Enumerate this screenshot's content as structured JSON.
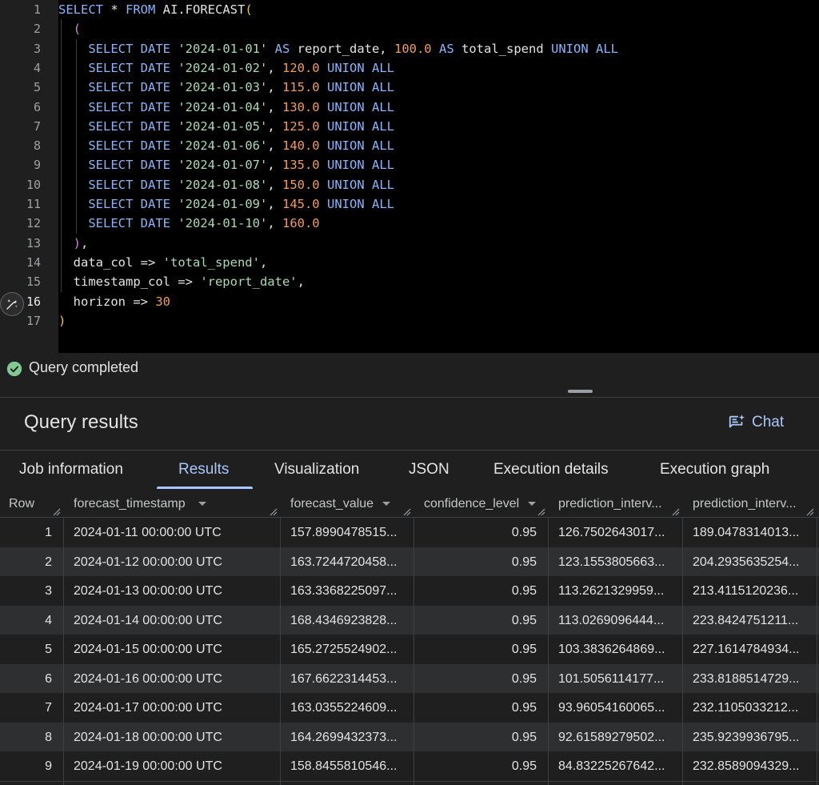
{
  "editor": {
    "line_numbers": [
      "1",
      "2",
      "3",
      "4",
      "5",
      "6",
      "7",
      "8",
      "9",
      "10",
      "11",
      "12",
      "13",
      "14",
      "15",
      "16",
      "17"
    ],
    "active_line": "16",
    "lines": [
      [
        {
          "t": "kw",
          "v": "SELECT"
        },
        {
          "t": "plain",
          "v": " * "
        },
        {
          "t": "kw",
          "v": "FROM"
        },
        {
          "t": "plain",
          "v": " AI.FORECAST"
        },
        {
          "t": "paren-o",
          "v": "("
        }
      ],
      [
        {
          "t": "plain",
          "v": "  "
        },
        {
          "t": "paren-p",
          "v": "("
        }
      ],
      [
        {
          "t": "plain",
          "v": "    "
        },
        {
          "t": "kw",
          "v": "SELECT DATE"
        },
        {
          "t": "plain",
          "v": " "
        },
        {
          "t": "str",
          "v": "'2024-01-01'"
        },
        {
          "t": "plain",
          "v": " "
        },
        {
          "t": "kw",
          "v": "AS"
        },
        {
          "t": "plain",
          "v": " report_date, "
        },
        {
          "t": "num",
          "v": "100.0"
        },
        {
          "t": "plain",
          "v": " "
        },
        {
          "t": "kw",
          "v": "AS"
        },
        {
          "t": "plain",
          "v": " total_spend "
        },
        {
          "t": "kw",
          "v": "UNION ALL"
        }
      ],
      [
        {
          "t": "plain",
          "v": "    "
        },
        {
          "t": "kw",
          "v": "SELECT DATE"
        },
        {
          "t": "plain",
          "v": " "
        },
        {
          "t": "str",
          "v": "'2024-01-02'"
        },
        {
          "t": "plain",
          "v": ", "
        },
        {
          "t": "num",
          "v": "120.0"
        },
        {
          "t": "plain",
          "v": " "
        },
        {
          "t": "kw",
          "v": "UNION ALL"
        }
      ],
      [
        {
          "t": "plain",
          "v": "    "
        },
        {
          "t": "kw",
          "v": "SELECT DATE"
        },
        {
          "t": "plain",
          "v": " "
        },
        {
          "t": "str",
          "v": "'2024-01-03'"
        },
        {
          "t": "plain",
          "v": ", "
        },
        {
          "t": "num",
          "v": "115.0"
        },
        {
          "t": "plain",
          "v": " "
        },
        {
          "t": "kw",
          "v": "UNION ALL"
        }
      ],
      [
        {
          "t": "plain",
          "v": "    "
        },
        {
          "t": "kw",
          "v": "SELECT DATE"
        },
        {
          "t": "plain",
          "v": " "
        },
        {
          "t": "str",
          "v": "'2024-01-04'"
        },
        {
          "t": "plain",
          "v": ", "
        },
        {
          "t": "num",
          "v": "130.0"
        },
        {
          "t": "plain",
          "v": " "
        },
        {
          "t": "kw",
          "v": "UNION ALL"
        }
      ],
      [
        {
          "t": "plain",
          "v": "    "
        },
        {
          "t": "kw",
          "v": "SELECT DATE"
        },
        {
          "t": "plain",
          "v": " "
        },
        {
          "t": "str",
          "v": "'2024-01-05'"
        },
        {
          "t": "plain",
          "v": ", "
        },
        {
          "t": "num",
          "v": "125.0"
        },
        {
          "t": "plain",
          "v": " "
        },
        {
          "t": "kw",
          "v": "UNION ALL"
        }
      ],
      [
        {
          "t": "plain",
          "v": "    "
        },
        {
          "t": "kw",
          "v": "SELECT DATE"
        },
        {
          "t": "plain",
          "v": " "
        },
        {
          "t": "str",
          "v": "'2024-01-06'"
        },
        {
          "t": "plain",
          "v": ", "
        },
        {
          "t": "num",
          "v": "140.0"
        },
        {
          "t": "plain",
          "v": " "
        },
        {
          "t": "kw",
          "v": "UNION ALL"
        }
      ],
      [
        {
          "t": "plain",
          "v": "    "
        },
        {
          "t": "kw",
          "v": "SELECT DATE"
        },
        {
          "t": "plain",
          "v": " "
        },
        {
          "t": "str",
          "v": "'2024-01-07'"
        },
        {
          "t": "plain",
          "v": ", "
        },
        {
          "t": "num",
          "v": "135.0"
        },
        {
          "t": "plain",
          "v": " "
        },
        {
          "t": "kw",
          "v": "UNION ALL"
        }
      ],
      [
        {
          "t": "plain",
          "v": "    "
        },
        {
          "t": "kw",
          "v": "SELECT DATE"
        },
        {
          "t": "plain",
          "v": " "
        },
        {
          "t": "str",
          "v": "'2024-01-08'"
        },
        {
          "t": "plain",
          "v": ", "
        },
        {
          "t": "num",
          "v": "150.0"
        },
        {
          "t": "plain",
          "v": " "
        },
        {
          "t": "kw",
          "v": "UNION ALL"
        }
      ],
      [
        {
          "t": "plain",
          "v": "    "
        },
        {
          "t": "kw",
          "v": "SELECT DATE"
        },
        {
          "t": "plain",
          "v": " "
        },
        {
          "t": "str",
          "v": "'2024-01-09'"
        },
        {
          "t": "plain",
          "v": ", "
        },
        {
          "t": "num",
          "v": "145.0"
        },
        {
          "t": "plain",
          "v": " "
        },
        {
          "t": "kw",
          "v": "UNION ALL"
        }
      ],
      [
        {
          "t": "plain",
          "v": "    "
        },
        {
          "t": "kw",
          "v": "SELECT DATE"
        },
        {
          "t": "plain",
          "v": " "
        },
        {
          "t": "str",
          "v": "'2024-01-10'"
        },
        {
          "t": "plain",
          "v": ", "
        },
        {
          "t": "num",
          "v": "160.0"
        }
      ],
      [
        {
          "t": "plain",
          "v": "  "
        },
        {
          "t": "paren-p",
          "v": ")"
        },
        {
          "t": "plain",
          "v": ","
        }
      ],
      [
        {
          "t": "plain",
          "v": "  data_col => "
        },
        {
          "t": "str",
          "v": "'total_spend'"
        },
        {
          "t": "plain",
          "v": ","
        }
      ],
      [
        {
          "t": "plain",
          "v": "  timestamp_col => "
        },
        {
          "t": "str",
          "v": "'report_date'"
        },
        {
          "t": "plain",
          "v": ","
        }
      ],
      [
        {
          "t": "plain",
          "v": "  horizon => "
        },
        {
          "t": "num",
          "v": "30"
        }
      ],
      [
        {
          "t": "paren-o",
          "v": ")"
        }
      ]
    ]
  },
  "status": {
    "text": "Query completed",
    "icon": "check-circle-icon",
    "color": "#81c995"
  },
  "results": {
    "title": "Query results",
    "chat_label": "Chat",
    "tabs": [
      "Job information",
      "Results",
      "Visualization",
      "JSON",
      "Execution details",
      "Execution graph"
    ],
    "active_tab": "Results"
  },
  "table": {
    "columns": [
      "Row",
      "forecast_timestamp",
      "forecast_value",
      "confidence_level",
      "prediction_interv...",
      "prediction_interv..."
    ],
    "rows": [
      [
        "1",
        "2024-01-11 00:00:00 UTC",
        "157.8990478515...",
        "0.95",
        "126.7502643017...",
        "189.0478314013..."
      ],
      [
        "2",
        "2024-01-12 00:00:00 UTC",
        "163.7244720458...",
        "0.95",
        "123.1553805663...",
        "204.2935635254..."
      ],
      [
        "3",
        "2024-01-13 00:00:00 UTC",
        "163.3368225097...",
        "0.95",
        "113.2621329959...",
        "213.4115120236..."
      ],
      [
        "4",
        "2024-01-14 00:00:00 UTC",
        "168.4346923828...",
        "0.95",
        "113.0269096444...",
        "223.8424751211..."
      ],
      [
        "5",
        "2024-01-15 00:00:00 UTC",
        "165.2725524902...",
        "0.95",
        "103.3836264869...",
        "227.1614784934..."
      ],
      [
        "6",
        "2024-01-16 00:00:00 UTC",
        "167.6622314453...",
        "0.95",
        "101.5056114177...",
        "233.8188514729..."
      ],
      [
        "7",
        "2024-01-17 00:00:00 UTC",
        "163.0355224609...",
        "0.95",
        "93.96054160065...",
        "232.1105033212..."
      ],
      [
        "8",
        "2024-01-18 00:00:00 UTC",
        "164.2699432373...",
        "0.95",
        "92.61589279502...",
        "235.9239936795..."
      ],
      [
        "9",
        "2024-01-19 00:00:00 UTC",
        "158.8455810546...",
        "0.95",
        "84.83225267642...",
        "232.8589094329..."
      ]
    ]
  }
}
